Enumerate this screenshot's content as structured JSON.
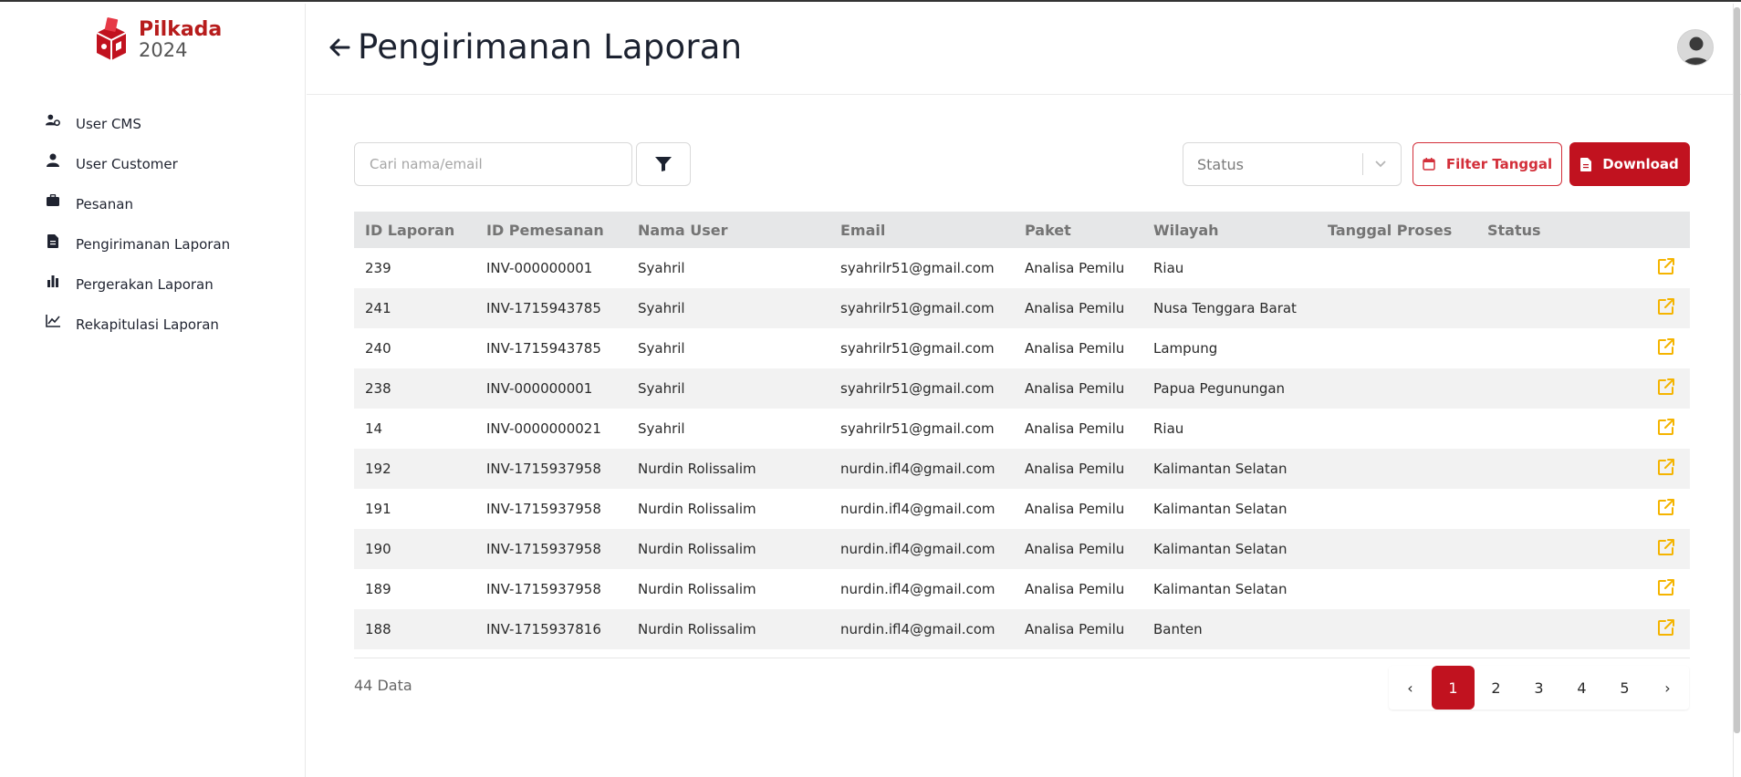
{
  "app": {
    "logo_brand": "Pilkada",
    "logo_year": "2024",
    "brand_color": "#c1121f"
  },
  "sidebar": {
    "items": [
      {
        "label": "User CMS",
        "icon": "user-cog-icon"
      },
      {
        "label": "User Customer",
        "icon": "user-icon"
      },
      {
        "label": "Pesanan",
        "icon": "briefcase-icon"
      },
      {
        "label": "Pengirimanan Laporan",
        "icon": "file-icon"
      },
      {
        "label": "Pergerakan Laporan",
        "icon": "bar-chart-icon"
      },
      {
        "label": "Rekapitulasi Laporan",
        "icon": "line-chart-icon"
      }
    ]
  },
  "header": {
    "title": "Pengirimanan Laporan"
  },
  "toolbar": {
    "search_placeholder": "Cari nama/email",
    "search_value": "",
    "status_value": "Status",
    "filter_date_label": "Filter Tanggal",
    "download_label": "Download"
  },
  "table": {
    "columns": [
      "ID Laporan",
      "ID Pemesanan",
      "Nama User",
      "Email",
      "Paket",
      "Wilayah",
      "Tanggal Proses",
      "Status"
    ],
    "rows": [
      [
        "239",
        "INV-000000001",
        "Syahril",
        "syahrilr51@gmail.com",
        "Analisa Pemilu",
        "Riau",
        "",
        ""
      ],
      [
        "241",
        "INV-1715943785",
        "Syahril",
        "syahrilr51@gmail.com",
        "Analisa Pemilu",
        "Nusa Tenggara Barat",
        "",
        ""
      ],
      [
        "240",
        "INV-1715943785",
        "Syahril",
        "syahrilr51@gmail.com",
        "Analisa Pemilu",
        "Lampung",
        "",
        ""
      ],
      [
        "238",
        "INV-000000001",
        "Syahril",
        "syahrilr51@gmail.com",
        "Analisa Pemilu",
        "Papua Pegunungan",
        "",
        ""
      ],
      [
        "14",
        "INV-0000000021",
        "Syahril",
        "syahrilr51@gmail.com",
        "Analisa Pemilu",
        "Riau",
        "",
        ""
      ],
      [
        "192",
        "INV-1715937958",
        "Nurdin Rolissalim",
        "nurdin.ifl4@gmail.com",
        "Analisa Pemilu",
        "Kalimantan Selatan",
        "",
        ""
      ],
      [
        "191",
        "INV-1715937958",
        "Nurdin Rolissalim",
        "nurdin.ifl4@gmail.com",
        "Analisa Pemilu",
        "Kalimantan Selatan",
        "",
        ""
      ],
      [
        "190",
        "INV-1715937958",
        "Nurdin Rolissalim",
        "nurdin.ifl4@gmail.com",
        "Analisa Pemilu",
        "Kalimantan Selatan",
        "",
        ""
      ],
      [
        "189",
        "INV-1715937958",
        "Nurdin Rolissalim",
        "nurdin.ifl4@gmail.com",
        "Analisa Pemilu",
        "Kalimantan Selatan",
        "",
        ""
      ],
      [
        "188",
        "INV-1715937816",
        "Nurdin Rolissalim",
        "nurdin.ifl4@gmail.com",
        "Analisa Pemilu",
        "Banten",
        "",
        ""
      ]
    ],
    "row_action_icon": "external-link-icon",
    "action_color": "#f5b400"
  },
  "footer": {
    "data_count": "44 Data",
    "pagination": {
      "prev": "‹",
      "pages": [
        "1",
        "2",
        "3",
        "4",
        "5"
      ],
      "active": "1",
      "next": "›"
    }
  }
}
